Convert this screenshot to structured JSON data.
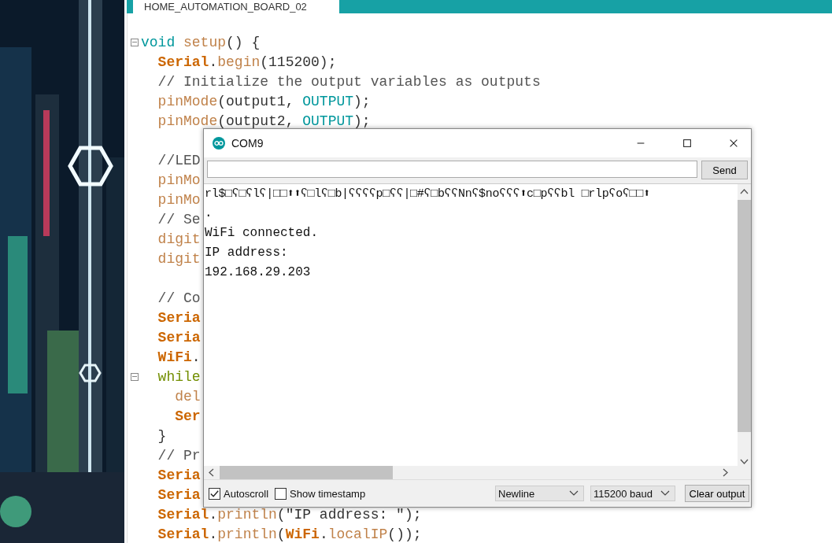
{
  "editor": {
    "tab": {
      "label": "HOME_AUTOMATION_BOARD_02",
      "selected": true
    },
    "lines": [
      {
        "fold": true,
        "tokens": [
          {
            "kind": "type",
            "text": "void"
          },
          {
            "kind": "func",
            "text": " setup"
          },
          {
            "kind": "plain",
            "text": "() {"
          }
        ]
      },
      {
        "fold": false,
        "tokens": [
          {
            "kind": "class",
            "text": "  Serial"
          },
          {
            "kind": "plain",
            "text": "."
          },
          {
            "kind": "func",
            "text": "begin"
          },
          {
            "kind": "plain",
            "text": "(115200);"
          }
        ]
      },
      {
        "fold": false,
        "tokens": [
          {
            "kind": "comment",
            "text": "  // Initialize the output variables as outputs"
          }
        ]
      },
      {
        "fold": false,
        "tokens": [
          {
            "kind": "func",
            "text": "  pinMode"
          },
          {
            "kind": "plain",
            "text": "(output1, "
          },
          {
            "kind": "type",
            "text": "OUTPUT"
          },
          {
            "kind": "plain",
            "text": ");"
          }
        ]
      },
      {
        "fold": false,
        "tokens": [
          {
            "kind": "func",
            "text": "  pinMode"
          },
          {
            "kind": "plain",
            "text": "(output2, "
          },
          {
            "kind": "type",
            "text": "OUTPUT"
          },
          {
            "kind": "plain",
            "text": ");"
          }
        ]
      },
      {
        "fold": false
      },
      {
        "fold": false,
        "tokens": [
          {
            "kind": "comment",
            "text": "  //LED"
          }
        ]
      },
      {
        "fold": false,
        "tokens": [
          {
            "kind": "func",
            "text": "  pinMo"
          }
        ]
      },
      {
        "fold": false,
        "tokens": [
          {
            "kind": "func",
            "text": "  pinMo"
          }
        ]
      },
      {
        "fold": false,
        "tokens": [
          {
            "kind": "comment",
            "text": "  // Se"
          }
        ]
      },
      {
        "fold": false,
        "tokens": [
          {
            "kind": "func",
            "text": "  digit"
          }
        ]
      },
      {
        "fold": false,
        "tokens": [
          {
            "kind": "func",
            "text": "  digit"
          }
        ]
      },
      {
        "fold": false
      },
      {
        "fold": false,
        "tokens": [
          {
            "kind": "comment",
            "text": "  // Co"
          }
        ]
      },
      {
        "fold": false,
        "tokens": [
          {
            "kind": "class",
            "text": "  Seria"
          }
        ]
      },
      {
        "fold": false,
        "tokens": [
          {
            "kind": "class",
            "text": "  Seria"
          }
        ]
      },
      {
        "fold": false,
        "tokens": [
          {
            "kind": "class",
            "text": "  WiFi"
          },
          {
            "kind": "plain",
            "text": "."
          }
        ]
      },
      {
        "fold": true,
        "tokens": [
          {
            "kind": "control",
            "text": "  while"
          }
        ]
      },
      {
        "fold": false,
        "tokens": [
          {
            "kind": "func",
            "text": "    del"
          }
        ]
      },
      {
        "fold": false,
        "tokens": [
          {
            "kind": "class",
            "text": "    Ser"
          }
        ]
      },
      {
        "fold": false,
        "tokens": [
          {
            "kind": "plain",
            "text": "  }"
          }
        ]
      },
      {
        "fold": false,
        "tokens": [
          {
            "kind": "comment",
            "text": "  // Pr"
          }
        ]
      },
      {
        "fold": false,
        "tokens": [
          {
            "kind": "class",
            "text": "  Seria"
          }
        ]
      },
      {
        "fold": false,
        "tokens": [
          {
            "kind": "class",
            "text": "  Seria"
          }
        ]
      },
      {
        "fold": false,
        "tokens": [
          {
            "kind": "class",
            "text": "  Serial"
          },
          {
            "kind": "plain",
            "text": "."
          },
          {
            "kind": "func",
            "text": "println"
          },
          {
            "kind": "plain",
            "text": "(\"IP address: \");"
          }
        ]
      },
      {
        "fold": false,
        "tokens": [
          {
            "kind": "class",
            "text": "  Serial"
          },
          {
            "kind": "plain",
            "text": "."
          },
          {
            "kind": "func",
            "text": "println"
          },
          {
            "kind": "plain",
            "text": "("
          },
          {
            "kind": "class",
            "text": "WiFi"
          },
          {
            "kind": "plain",
            "text": "."
          },
          {
            "kind": "func",
            "text": "localIP"
          },
          {
            "kind": "plain",
            "text": "());"
          }
        ]
      }
    ]
  },
  "serial_monitor": {
    "title": "COM9",
    "send_button": "Send",
    "output_lines": [
      "rl$□ʕ□ʕlʕ|□□⬆⬆ʕ□lʕ□b|ʕʕʕʕp□ʕʕ|□#ʕ□bʕʕNnʕ$noʕʕʕ⬆c□pʕʕbl □rlpʕoʕ□□⬆",
      ".",
      "WiFi connected.",
      "IP address:",
      "192.168.29.203"
    ],
    "autoscroll": {
      "label": "Autoscroll",
      "checked": true
    },
    "timestamp": {
      "label": "Show timestamp",
      "checked": false
    },
    "line_ending": "Newline",
    "baud_rate": "115200 baud",
    "clear_button": "Clear output"
  }
}
